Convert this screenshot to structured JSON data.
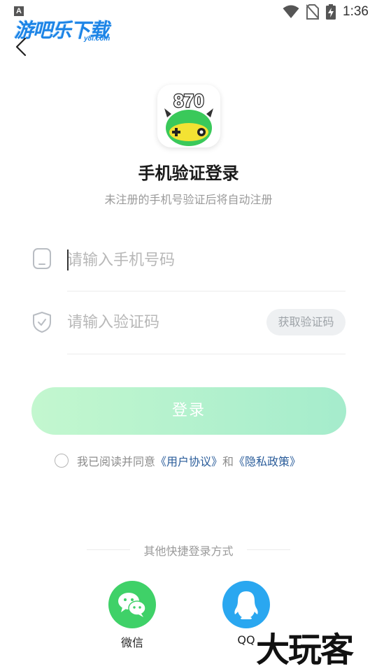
{
  "status_bar": {
    "badge": "A",
    "time": "1:36",
    "icons": [
      "wifi-icon",
      "no-sim-icon",
      "battery-charging-icon"
    ]
  },
  "watermark": {
    "main": "游吧乐下载",
    "sub": "y8l.com"
  },
  "nav": {
    "back_icon": "chevron-left-icon"
  },
  "app_icon": {
    "text": "870",
    "colors": {
      "frog": "#3ac95a",
      "horn": "#333333",
      "bg": "#ffffff"
    }
  },
  "header": {
    "title": "手机验证登录",
    "subtitle": "未注册的手机号验证后将自动注册"
  },
  "phone": {
    "placeholder": "请输入手机号码",
    "value": "",
    "icon": "phone-icon"
  },
  "code": {
    "placeholder": "请输入验证码",
    "value": "",
    "icon": "shield-icon",
    "button": "获取验证码"
  },
  "login_button": "登录",
  "agreement": {
    "prefix": "我已阅读并同意",
    "user_agreement": "《用户协议》",
    "and": "和",
    "privacy": "《隐私政策》"
  },
  "other_login": {
    "label": "其他快捷登录方式",
    "methods": [
      {
        "label": "微信",
        "icon": "wechat-icon",
        "color": "#3fd168"
      },
      {
        "label": "QQ",
        "icon": "qq-icon",
        "color": "#2aa7f0"
      }
    ]
  },
  "corner_watermark": "大玩客",
  "colors": {
    "login_gradient_start": "#c3f7cf",
    "login_gradient_end": "#a5eccc",
    "link": "#2a5c9a"
  }
}
